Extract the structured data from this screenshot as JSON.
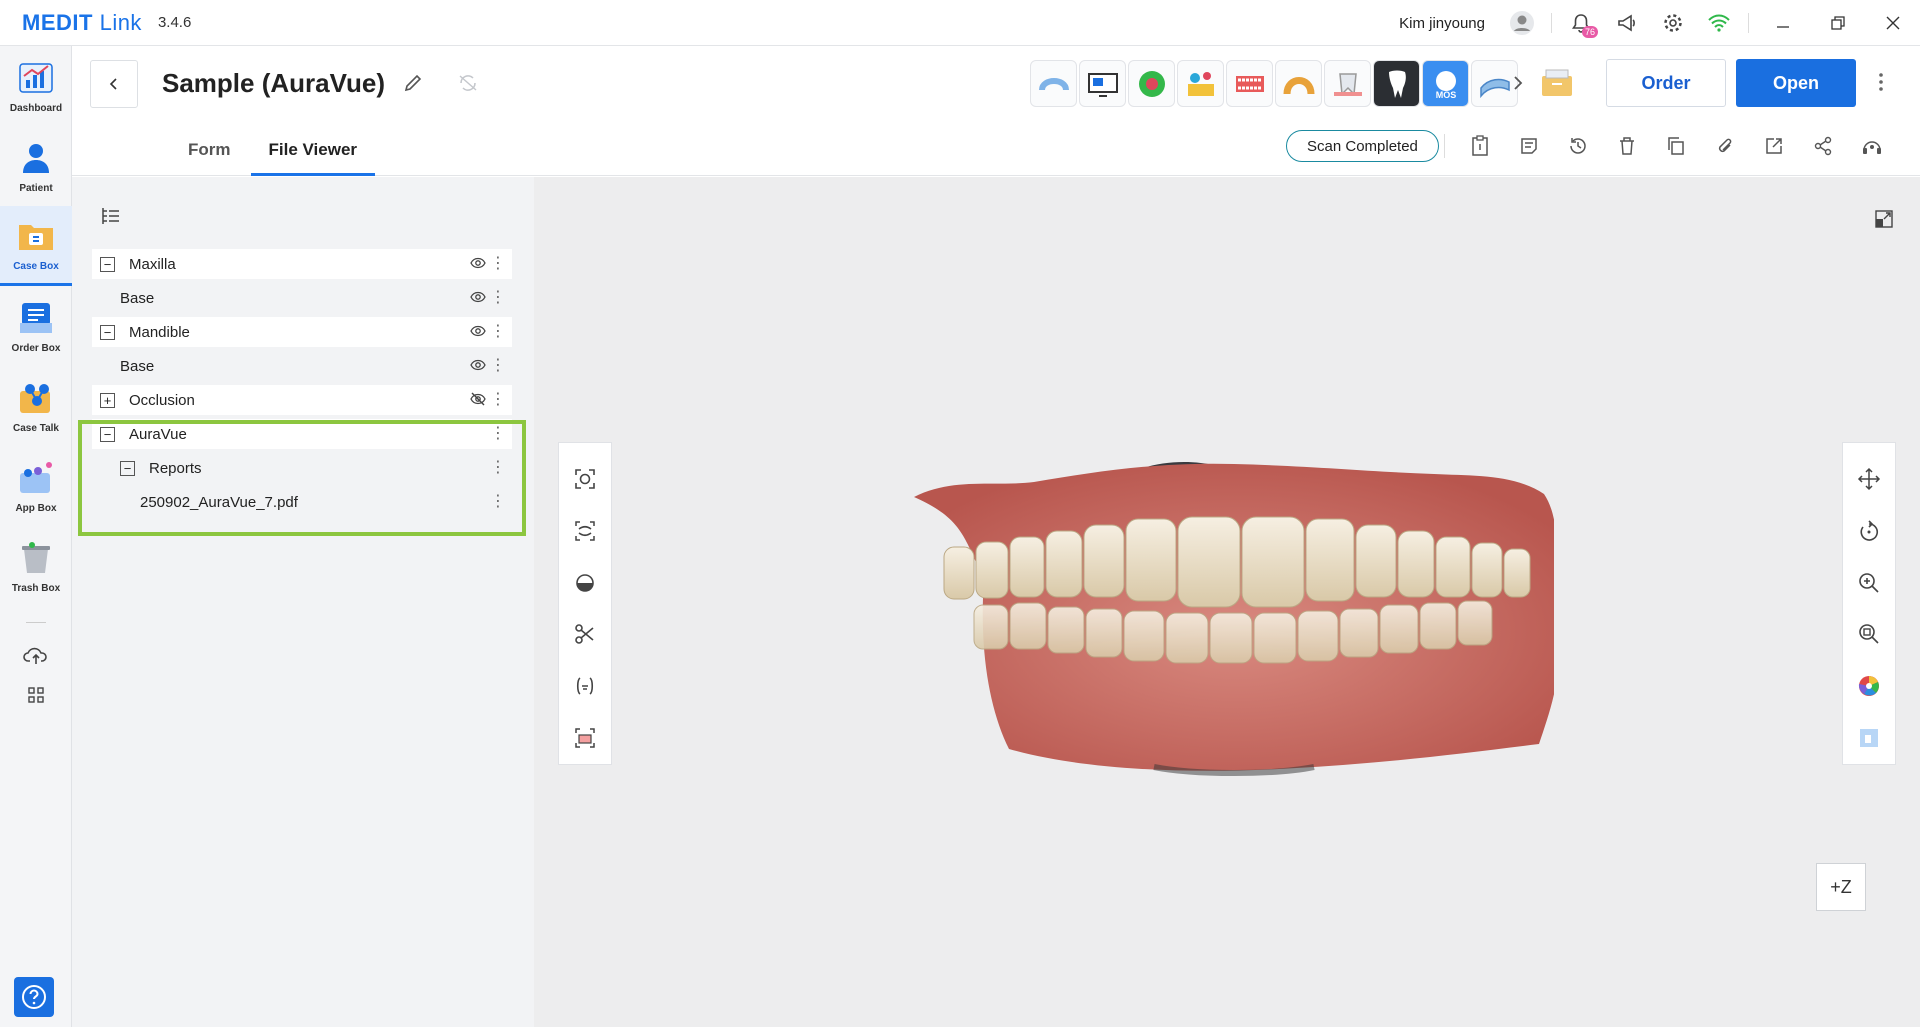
{
  "app": {
    "name_main": "MEDIT",
    "name_sub": "Link",
    "version": "3.4.6"
  },
  "titlebar": {
    "user_name": "Kim jinyoung",
    "notification_count": "76"
  },
  "nav": [
    {
      "label": "Dashboard"
    },
    {
      "label": "Patient"
    },
    {
      "label": "Case Box"
    },
    {
      "label": "Order Box"
    },
    {
      "label": "Case Talk"
    },
    {
      "label": "App Box"
    },
    {
      "label": "Trash Box"
    }
  ],
  "header": {
    "title": "Sample (AuraVue)",
    "order_label": "Order",
    "open_label": "Open",
    "status": "Scan Completed",
    "tabs": [
      {
        "label": "Form"
      },
      {
        "label": "File Viewer"
      }
    ]
  },
  "tree": {
    "items": [
      {
        "label": "Maxilla"
      },
      {
        "label": "Base"
      },
      {
        "label": "Mandible"
      },
      {
        "label": "Base"
      },
      {
        "label": "Occlusion"
      },
      {
        "label": "AuraVue"
      },
      {
        "label": "Reports"
      },
      {
        "label": "250902_AuraVue_7.pdf"
      }
    ]
  },
  "viewer": {
    "axis_label": "+Z"
  },
  "colors": {
    "accent": "#1a73e8",
    "highlight": "#8cc63f",
    "badge": "#e85aa6"
  }
}
